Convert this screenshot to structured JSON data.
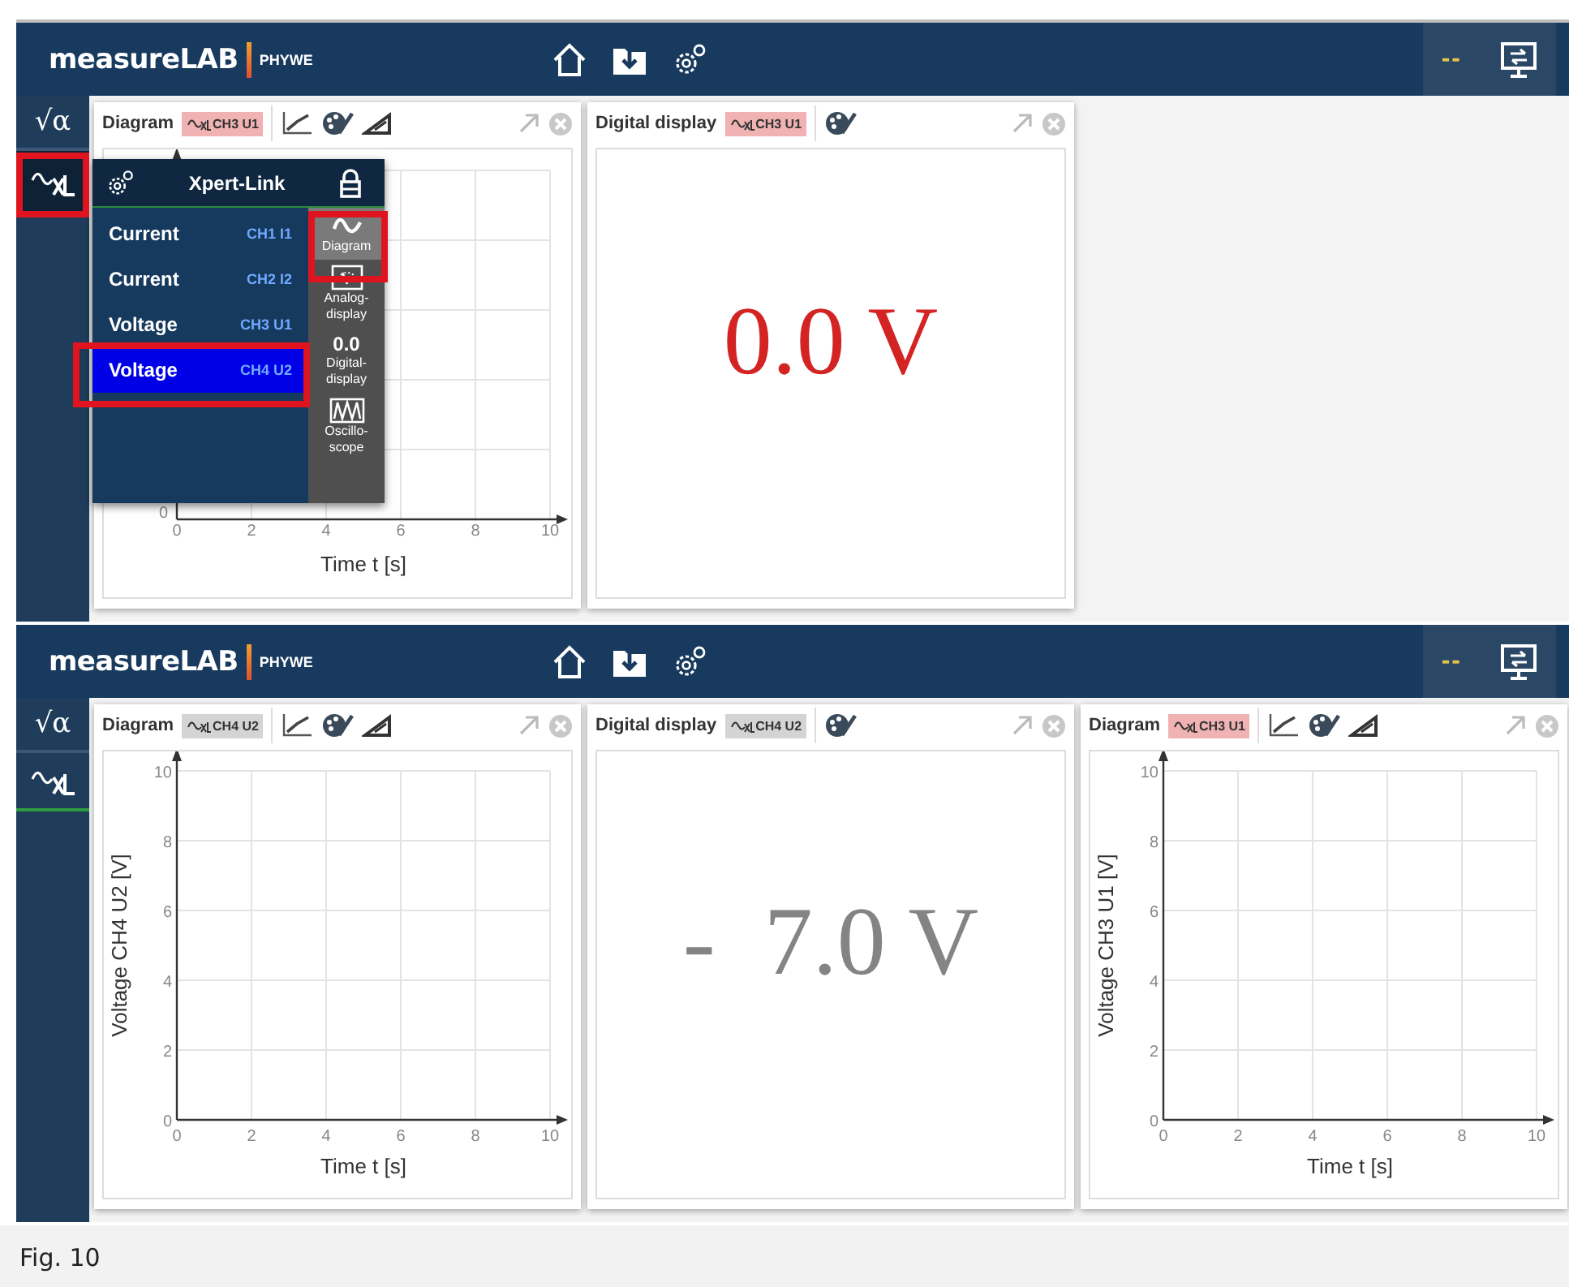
{
  "screens": [
    {
      "header": {
        "logo": "measureLAB",
        "brand": "PHYWE",
        "indicator": "--"
      },
      "sidebar": {
        "formula": "√α"
      },
      "panels": [
        {
          "kind": "diagram",
          "title": "Diagram",
          "channel": "CH3 U1",
          "color": "#f0b2b2",
          "axes": {
            "xlabel": "Time t [s]",
            "x_tick_labels": [
              "0",
              "2",
              "4",
              "6",
              "8",
              "10"
            ],
            "y_tick_labels": [
              "0"
            ]
          }
        },
        {
          "kind": "digital",
          "title": "Digital display",
          "channel": "CH3 U1",
          "color": "#f0b2b2",
          "value": "0.0 V"
        }
      ],
      "popup": {
        "title": "Xpert-Link",
        "channels": [
          {
            "label": "Current",
            "channel": "CH1 I1",
            "selected": false
          },
          {
            "label": "Current",
            "channel": "CH2 I2",
            "selected": false
          },
          {
            "label": "Voltage",
            "channel": "CH3 U1",
            "selected": false
          },
          {
            "label": "Voltage",
            "channel": "CH4 U2",
            "selected": true
          }
        ],
        "views": [
          {
            "kind": "diagram",
            "label": "Diagram",
            "selected": true
          },
          {
            "kind": "analog",
            "label": "Analog-display",
            "selected": false
          },
          {
            "kind": "digital",
            "glyph": "0.0",
            "label": "Digital-display",
            "selected": false
          },
          {
            "kind": "scope",
            "label": "Oscillo-scope",
            "selected": false
          }
        ]
      }
    },
    {
      "header": {
        "logo": "measureLAB",
        "brand": "PHYWE",
        "indicator": "--"
      },
      "sidebar": {
        "formula": "√α"
      },
      "panels": [
        {
          "kind": "diagram",
          "title": "Diagram",
          "channel": "CH4 U2",
          "color": "#d4d4d4",
          "chart_data": {
            "type": "line",
            "grid": true,
            "xlabel": "Time t [s]",
            "ylabel": "Voltage CH4 U2 [V]",
            "xticks": [
              0,
              2,
              4,
              6,
              8,
              10
            ],
            "yticks": [
              0,
              2,
              4,
              6,
              8,
              10
            ],
            "xlim": [
              0,
              10
            ],
            "ylim": [
              0,
              10
            ]
          }
        },
        {
          "kind": "digital",
          "title": "Digital display",
          "channel": "CH4 U2",
          "color": "#d4d4d4",
          "value": "-  7.0 V"
        },
        {
          "kind": "diagram",
          "title": "Diagram",
          "channel": "CH3 U1",
          "color": "#f0b2b2",
          "chart_data": {
            "type": "line",
            "grid": true,
            "xlabel": "Time t [s]",
            "ylabel": "Voltage CH3 U1 [V]",
            "xticks": [
              0,
              2,
              4,
              6,
              8,
              10
            ],
            "yticks": [
              0,
              2,
              4,
              6,
              8,
              10
            ],
            "xlim": [
              0,
              10
            ],
            "ylim": [
              0,
              10
            ]
          }
        }
      ]
    }
  ],
  "caption": "Fig. 10"
}
